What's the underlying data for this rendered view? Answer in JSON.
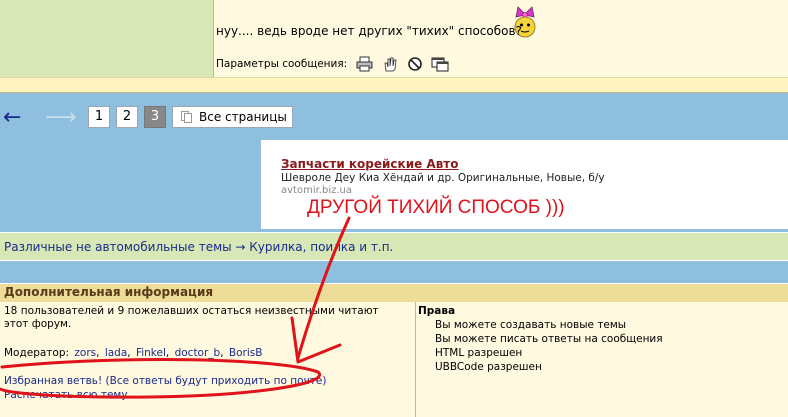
{
  "post": {
    "text": "нуу.... ведь вроде нет других \"тихих\" способов?",
    "params_label": "Параметры сообщения:",
    "params_icons": [
      "print-icon",
      "hand-icon",
      "ban-icon",
      "window-icon"
    ]
  },
  "pagination": {
    "prev_symbol": "←",
    "next_symbol": "⟶",
    "pages": [
      "1",
      "2",
      "3"
    ],
    "current_page": "3",
    "all_pages_label": "Все страницы"
  },
  "ad": {
    "title": "Запчасти корейские Авто",
    "description": "Шевроле Деу Киа Хёндай и др. Оригинальные, Новые, б/у",
    "url": "avtomir.biz.ua"
  },
  "annotation": {
    "text": "ДРУГОЙ ТИХИЙ СПОСОБ )))",
    "color": "#e0121a"
  },
  "breadcrumb": {
    "text": "Различные не автомобильные темы → Курилка, поилка и т.п."
  },
  "info": {
    "header": "Дополнительная информация",
    "users_text": "18 пользователей и 9 пожелавших остаться неизвестными читают этот форум.",
    "moderator_label": "Модератор:",
    "moderators": [
      "zors",
      "lada",
      "Finkel",
      "doctor_b",
      "BorisB"
    ],
    "favorite_link": "Избранная ветвь! (Все ответы будут приходить по почте)",
    "print_link": "Распечатать всю тему",
    "rights_title": "Права",
    "rights": [
      "Вы можете создавать новые темы",
      "Вы можете писать ответы на сообщения",
      "HTML разрешен",
      "UBBCode разрешен"
    ]
  },
  "colors": {
    "background": "#8fbfde",
    "post_bg": "#fff9e0",
    "green_bar": "#d7e8b6",
    "header_bg": "#eedc99",
    "link": "#1a2a8a"
  }
}
